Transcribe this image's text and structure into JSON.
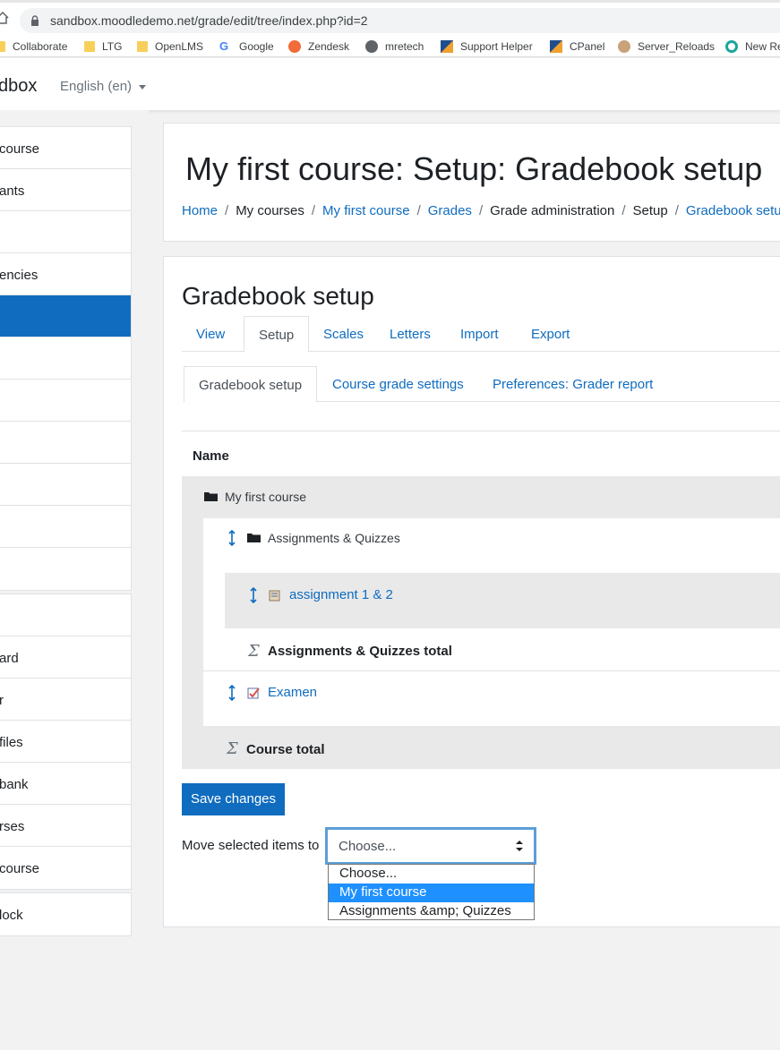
{
  "browser": {
    "url": "sandbox.moodledemo.net/grade/edit/tree/index.php?id=2",
    "bookmarks": [
      {
        "label": "Collaborate",
        "icon": "folder-icon"
      },
      {
        "label": "LTG",
        "icon": "folder-icon"
      },
      {
        "label": "OpenLMS",
        "icon": "folder-icon"
      },
      {
        "label": "Google",
        "icon": "google-icon"
      },
      {
        "label": "Zendesk",
        "icon": "zendesk-icon"
      },
      {
        "label": "mretech",
        "icon": "globe-icon"
      },
      {
        "label": "Support Helper",
        "icon": "bookmark-icon"
      },
      {
        "label": "CPanel",
        "icon": "bookmark-icon"
      },
      {
        "label": "Server_Reloads",
        "icon": "avatar-icon"
      },
      {
        "label": "New Re",
        "icon": "circle-icon"
      }
    ]
  },
  "navbar": {
    "brand": "dbox",
    "language": "English (en)"
  },
  "drawer": {
    "group1": [
      {
        "label": "course",
        "active": false
      },
      {
        "label": "ants",
        "active": false
      },
      {
        "label": "",
        "active": false
      },
      {
        "label": "encies",
        "active": false
      },
      {
        "label": "",
        "active": true
      },
      {
        "label": "",
        "active": false
      },
      {
        "label": "",
        "active": false
      },
      {
        "label": "",
        "active": false
      },
      {
        "label": "",
        "active": false
      },
      {
        "label": "",
        "active": false
      },
      {
        "label": "",
        "active": false
      }
    ],
    "group2": [
      {
        "label": ""
      },
      {
        "label": "ard"
      },
      {
        "label": "r"
      },
      {
        "label": "files"
      },
      {
        "label": " bank"
      },
      {
        "label": "rses"
      },
      {
        "label": " course"
      }
    ],
    "group3": [
      {
        "label": "lock"
      }
    ]
  },
  "header": {
    "title": "My first course: Setup: Gradebook setup",
    "breadcrumb": [
      {
        "label": "Home",
        "link": true
      },
      {
        "label": "My courses",
        "link": false
      },
      {
        "label": "My first course",
        "link": true
      },
      {
        "label": "Grades",
        "link": true
      },
      {
        "label": "Grade administration",
        "link": false
      },
      {
        "label": "Setup",
        "link": false
      },
      {
        "label": "Gradebook setu",
        "link": true
      }
    ]
  },
  "main": {
    "heading": "Gradebook setup",
    "tabs": [
      "View",
      "Setup",
      "Scales",
      "Letters",
      "Import",
      "Export"
    ],
    "subtabs": [
      "Gradebook setup",
      "Course grade settings",
      "Preferences: Grader report"
    ],
    "table": {
      "name_header": "Name",
      "course": "My first course",
      "category": "Assignments & Quizzes",
      "item1": "assignment 1 & 2",
      "category_total": "Assignments & Quizzes total",
      "item2": "Examen",
      "course_total": "Course total"
    },
    "save_label": "Save changes",
    "move_label": "Move selected items to",
    "select": {
      "value": "Choose...",
      "options": [
        "Choose...",
        "My first course",
        "Assignments &amp; Quizzes"
      ],
      "highlighted": 1
    }
  },
  "colors": {
    "primary": "#0f6cbf",
    "grey_row": "#e9e9e9",
    "highlight": "#1e90ff"
  }
}
